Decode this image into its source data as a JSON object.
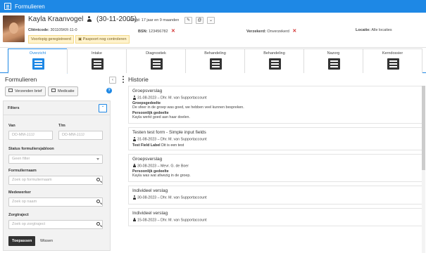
{
  "app": {
    "title": "Formulieren"
  },
  "client": {
    "name": "Kayla Kraanvogel",
    "dob": "(30-11-2005)",
    "age_text": "Leeftijd: 17 jaar en 9 maanden",
    "clientcode_label": "Cliëntcode:",
    "clientcode_value": "301105KR-11-0",
    "bsn_label": "BSN:",
    "bsn_value": "123456782",
    "verzekerd_label": "Verzekerd:",
    "verzekerd_value": "Onverzekerd",
    "locatie_label": "Locatie:",
    "locatie_value": "Alle locaties",
    "warning_1": "Voorlopig geregistreerd",
    "warning_2": "Paspoort nog controleren",
    "edit_glyph": "✎",
    "email_glyph": "@",
    "more_glyph": "⌄"
  },
  "tabs": [
    {
      "label": "Overzicht",
      "icon": "overview-icon"
    },
    {
      "label": "Intake",
      "icon": "intake-icon"
    },
    {
      "label": "Diagnostiek",
      "icon": "diagnostics-icon"
    },
    {
      "label": "Behandeling",
      "icon": "treatment-icon"
    },
    {
      "label": "Behandeling",
      "icon": "treatment-edit-icon"
    },
    {
      "label": "Nazorg",
      "icon": "aftercare-icon"
    },
    {
      "label": "Kerndossier",
      "icon": "core-file-icon"
    }
  ],
  "left_panel": {
    "title": "Formulieren",
    "collapse_glyph": "‹",
    "btn_send_letter": "Verzenden brief",
    "btn_medication": "Medicatie",
    "help_glyph": "?"
  },
  "filters": {
    "title": "Filters",
    "toggle_glyph": "⌃",
    "from_label": "Van",
    "from_placeholder": "DD-MM-JJJJ",
    "to_label": "T/m",
    "to_placeholder": "DD-MM-JJJJ",
    "status_label": "Status formuliersjabloon",
    "status_value": "Geen filter",
    "formname_label": "Formuliernaam",
    "formname_placeholder": "Zoek op formuliernaam",
    "employee_label": "Medewerker",
    "employee_placeholder": "Zoek op naam",
    "care_label": "Zorgtraject",
    "care_placeholder": "Zoek op zorgtraject",
    "apply": "Toepassen",
    "clear": "Wissen"
  },
  "history": {
    "title": "Historie",
    "items": [
      {
        "title": "Groepsverslag",
        "meta": "31-08-2023 – Dhr. M. van Supportaccount",
        "fields": [
          {
            "label": "Groepsgedeelte",
            "value": "De sfeer in de groep was goed, we hebben veel kunnen bespreken."
          },
          {
            "label": "Persoonlijk gedeelte",
            "value": "Kayla werkt goed aan haar doelen."
          }
        ]
      },
      {
        "title": "Testen test form - Simple input fields",
        "meta": "31-08-2023 – Dhr. M. van Supportaccount",
        "inline_label": "Test Field Label",
        "inline_value": "Dit is een test"
      },
      {
        "title": "Groepsverslag",
        "meta": "30-08-2023 – Mevr. G. de Boer",
        "fields": [
          {
            "label": "Persoonlijk gedeelte",
            "value": "Kayla was wat afwezig in de groep."
          }
        ]
      },
      {
        "title": "Individeel verslag",
        "meta": "30-08-2023 – Dhr. M. van Supportaccount"
      },
      {
        "title": "Individeel verslag",
        "meta": "15-08-2023 – Dhr. M. van Supportaccount"
      }
    ]
  }
}
